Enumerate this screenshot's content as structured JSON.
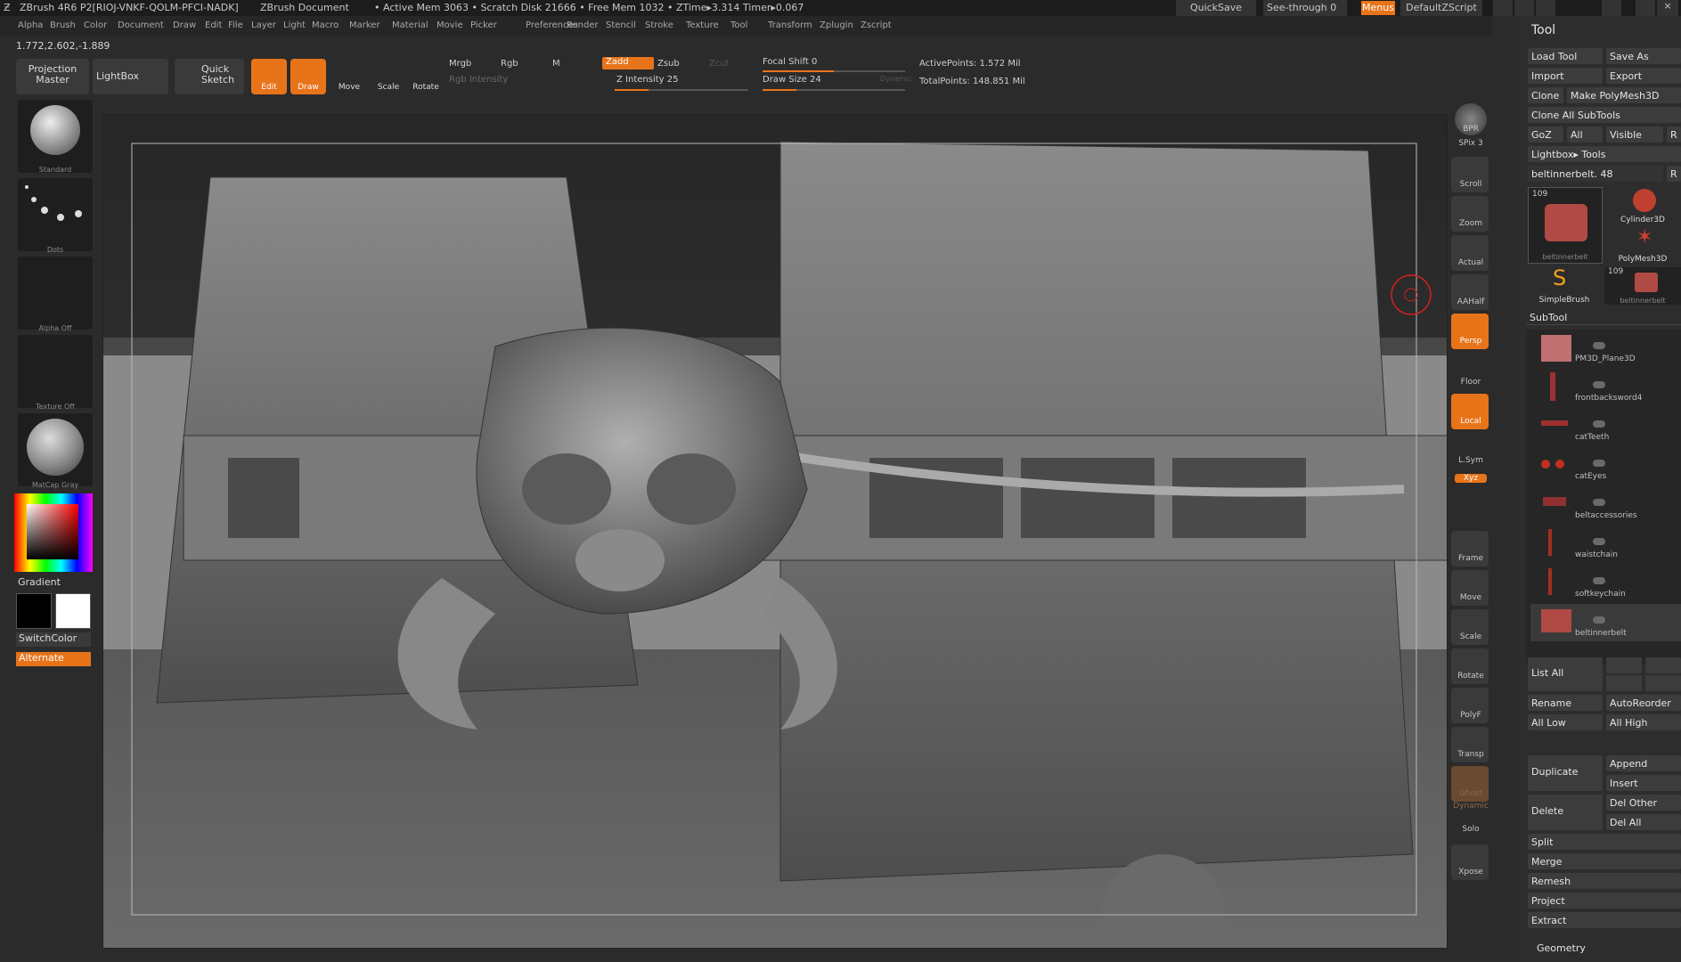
{
  "titlebar": {
    "app": "ZBrush 4R6 P2[RIOJ-VNKF-QOLM-PFCI-NADK]",
    "document": "ZBrush Document",
    "stats": "• Active Mem 3063 • Scratch Disk 21666 • Free Mem 1032 • ZTime▸3.314 Timer▸0.067",
    "quicksave": "QuickSave",
    "seethrough": "See-through  0",
    "menus": "Menus",
    "script": "DefaultZScript"
  },
  "menubar": {
    "items": [
      "Alpha",
      "Brush",
      "Color",
      "Document",
      "Draw",
      "Edit",
      "File",
      "Layer",
      "Light",
      "Macro",
      "Marker",
      "Material",
      "Movie",
      "Picker",
      "Preferences",
      "Render",
      "Stencil",
      "Stroke",
      "Texture",
      "Tool",
      "Transform",
      "Zplugin",
      "Zscript"
    ]
  },
  "coords": "1.772,2.602,-1.889",
  "toolbar": {
    "projection_master": "Projection Master",
    "lightbox": "LightBox",
    "quick_sketch": "Quick Sketch",
    "edit": "Edit",
    "draw": "Draw",
    "move": "Move",
    "scale": "Scale",
    "rotate": "Rotate",
    "mrgb": "Mrgb",
    "rgb": "Rgb",
    "m": "M",
    "rgb_intensity": "Rgb Intensity",
    "zadd": "Zadd",
    "zsub": "Zsub",
    "zcut": "Zcut",
    "z_intensity": "Z Intensity 25",
    "focal_shift": "Focal Shift 0",
    "draw_size": "Draw Size 24",
    "dynamic": "Dynamic",
    "active_points": "ActivePoints: 1.572 Mil",
    "total_points": "TotalPoints: 148.851 Mil",
    "z_intensity_value": 25,
    "z_intensity_max": 100,
    "draw_size_value": 24,
    "draw_size_max": 100
  },
  "leftshelf": {
    "brush": "Standard",
    "stroke": "Dots",
    "alpha": "Alpha  Off",
    "texture": "Texture  Off",
    "material": "MatCap  Gray",
    "gradient": "Gradient",
    "switchcolor": "SwitchColor",
    "alternate": "Alternate"
  },
  "rightshelf": {
    "items": [
      "BPR",
      "SPix 3",
      "Scroll",
      "Zoom",
      "Actual",
      "AAHalf",
      "Persp",
      "Floor",
      "Local",
      "L.Sym",
      "Xyz",
      "Frame",
      "Move",
      "Scale",
      "Rotate",
      "PolyF",
      "Transp",
      "Ghost",
      "Dynamic",
      "Solo",
      "Xpose"
    ]
  },
  "toolpanel": {
    "title": "Tool",
    "load_tool": "Load Tool",
    "save_as": "Save As",
    "import": "Import",
    "export": "Export",
    "clone": "Clone",
    "make_polymesh": "Make PolyMesh3D",
    "clone_all": "Clone  All  SubTools",
    "goz": "GoZ",
    "all": "All",
    "visible": "Visible",
    "r": "R",
    "lightbox_tools": "Lightbox▸ Tools",
    "current_tool": "beltinnerbelt. 48",
    "tool_thumbs": [
      "beltinnerbelt",
      "Cylinder3D",
      "PolyMesh3D",
      "SimpleBrush",
      "beltinnerbelt"
    ],
    "tool_count_1": "109",
    "tool_count_2": "109",
    "subtool_title": "SubTool",
    "subtools": [
      "PM3D_Plane3D",
      "frontbacksword4",
      "catTeeth",
      "catEyes",
      "beltaccessories",
      "waistchain",
      "softkeychain",
      "beltinnerbelt"
    ],
    "list_all": "List  All",
    "rename": "Rename",
    "autoreorder": "AutoReorder",
    "all_low": "All  Low",
    "all_high": "All  High",
    "duplicate": "Duplicate",
    "append": "Append",
    "insert": "Insert",
    "delete": "Delete",
    "del_other": "Del  Other",
    "del_all": "Del  All",
    "split": "Split",
    "merge": "Merge",
    "remesh": "Remesh",
    "project": "Project",
    "extract": "Extract",
    "geometry": "Geometry"
  },
  "colors": {
    "accent": "#e8741a",
    "panel": "#2b2b2b"
  }
}
